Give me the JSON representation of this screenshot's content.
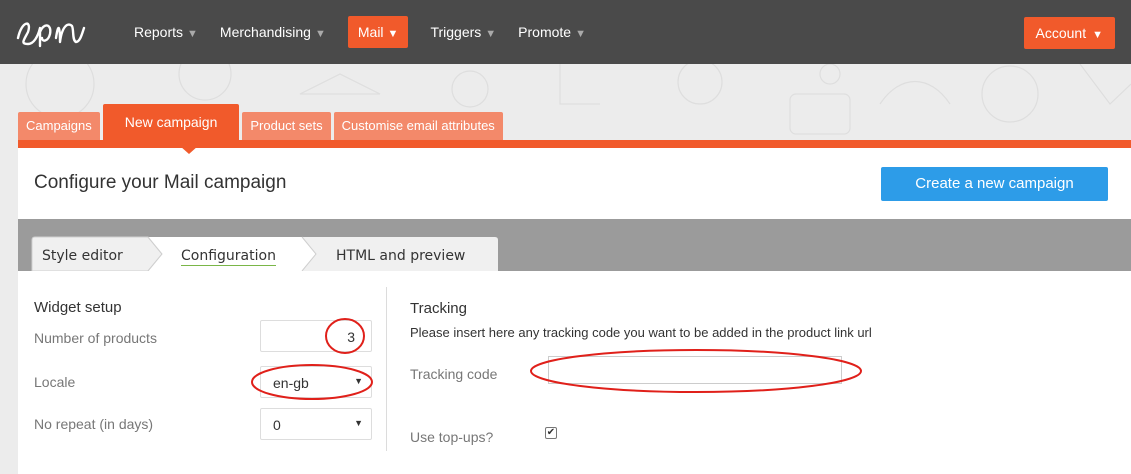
{
  "nav": {
    "logo_alt": "epi",
    "items": [
      {
        "label": "Reports"
      },
      {
        "label": "Merchandising"
      },
      {
        "label": "Mail"
      },
      {
        "label": "Triggers"
      },
      {
        "label": "Promote"
      }
    ],
    "active_index": 2,
    "account_label": "Account"
  },
  "tabs": {
    "items": [
      {
        "label": "Campaigns"
      },
      {
        "label": "New campaign"
      },
      {
        "label": "Product sets"
      },
      {
        "label": "Customise email attributes"
      }
    ],
    "active_index": 1
  },
  "page": {
    "title": "Configure your Mail campaign",
    "create_button": "Create a new campaign"
  },
  "steps": [
    {
      "label": "Style editor"
    },
    {
      "label": "Configuration"
    },
    {
      "label": "HTML and preview"
    }
  ],
  "widget_setup": {
    "title": "Widget setup",
    "number_of_products_label": "Number of products",
    "number_of_products_value": "3",
    "locale_label": "Locale",
    "locale_value": "en-gb",
    "no_repeat_label": "No repeat (in days)",
    "no_repeat_value": "0"
  },
  "tracking": {
    "title": "Tracking",
    "help": "Please insert here any tracking code you want to be added in the product link url",
    "code_label": "Tracking code",
    "code_value": "",
    "topups_label": "Use top-ups?",
    "topups_checked": true
  },
  "colors": {
    "brand_orange": "#f15a2b",
    "topbar": "#4a4a4a",
    "primary_blue": "#2d9ce8",
    "annotation_red": "#e0201a"
  }
}
